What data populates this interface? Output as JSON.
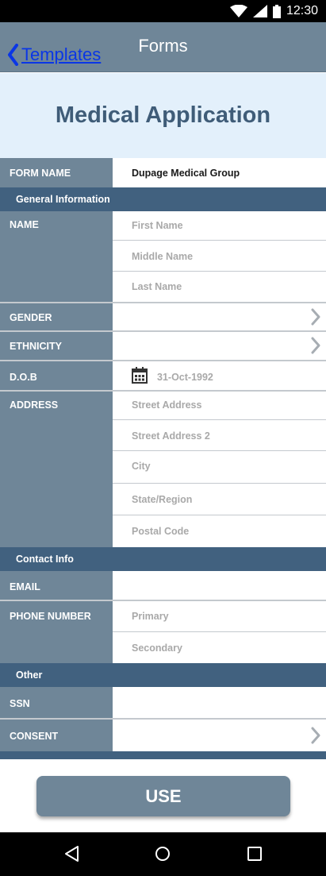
{
  "status_bar": {
    "time": "12:30",
    "icons": [
      "wifi-icon",
      "signal-icon",
      "battery-icon"
    ]
  },
  "app_bar": {
    "back_label": "Templates",
    "title": "Forms"
  },
  "page": {
    "title": "Medical Application"
  },
  "form": {
    "form_name": {
      "label": "FORM NAME",
      "value": "Dupage Medical Group"
    },
    "sections": {
      "general": "General Information",
      "contact": "Contact Info",
      "other": "Other"
    },
    "name": {
      "label": "NAME",
      "first_placeholder": "First Name",
      "middle_placeholder": "Middle Name",
      "last_placeholder": "Last Name"
    },
    "gender": {
      "label": "GENDER"
    },
    "ethnicity": {
      "label": "ETHNICITY"
    },
    "dob": {
      "label": "D.O.B",
      "placeholder": "31-Oct-1992"
    },
    "address": {
      "label": "ADDRESS",
      "street_placeholder": "Street Address",
      "street2_placeholder": "Street Address 2",
      "city_placeholder": "City",
      "state_placeholder": "State/Region",
      "postal_placeholder": "Postal Code"
    },
    "email": {
      "label": "EMAIL"
    },
    "phone": {
      "label": "PHONE NUMBER",
      "primary_placeholder": "Primary",
      "secondary_placeholder": "Secondary"
    },
    "ssn": {
      "label": "SSN"
    },
    "consent": {
      "label": "CONSENT"
    }
  },
  "actions": {
    "use_label": "USE"
  },
  "colors": {
    "header": "#6f8698",
    "section": "#41617f",
    "title": "#3f5c78",
    "band": "#e3f0fb",
    "link": "#0a36e6"
  }
}
